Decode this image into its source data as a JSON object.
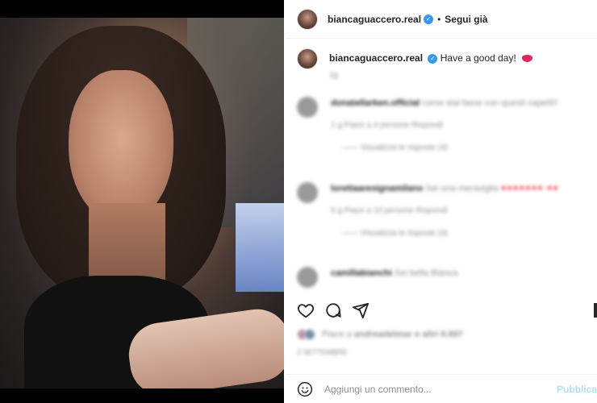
{
  "post": {
    "username": "biancaguaccero.real",
    "follow_label": "Segui già",
    "caption": "Have a good day!",
    "caption_time": "1g"
  },
  "comments": [
    {
      "username": "donatellarken.official",
      "text": "come stai bene con questi capelli!!",
      "meta": "1 g   Piace a 4 persone   Rispondi",
      "replies": "—— Visualizza le risposte (4)"
    },
    {
      "username": "lorettaaresignamilano",
      "text": "Sei una meraviglia",
      "meta": "5 g   Piace a 10 persone   Rispondi",
      "replies": "—— Visualizza le risposte (3)"
    },
    {
      "username": "camillabianchi",
      "text": "Sei bella Bianca"
    }
  ],
  "likes": {
    "prefix": "Piace a",
    "who": "andreadelmar",
    "suffix": "e altri 8.897"
  },
  "date": "2 SETTEMBRE",
  "add_comment": {
    "placeholder": "Aggiungi un commento...",
    "post_label": "Pubblica"
  },
  "colors": {
    "verified": "#3897f0",
    "heart": "#ed4956",
    "post_button": "#b2dffc"
  },
  "icons": [
    "heart-icon",
    "comment-icon",
    "share-icon",
    "bookmark-icon",
    "emoji-icon",
    "verified-badge-icon"
  ]
}
